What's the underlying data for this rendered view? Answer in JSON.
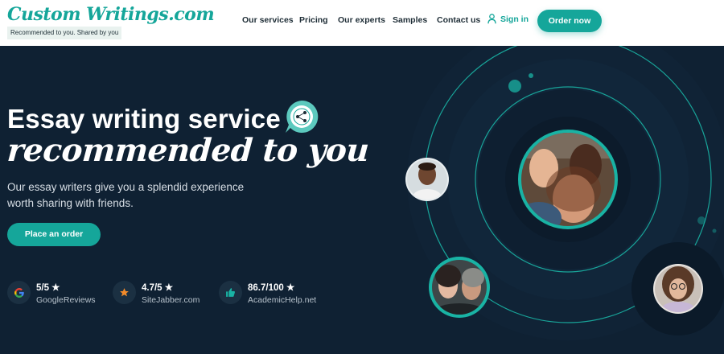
{
  "header": {
    "logo": "Custom Writings.com",
    "tagline": "Recommended to you. Shared by you",
    "nav": [
      "Our services",
      "Pricing",
      "Our experts",
      "Samples",
      "Contact us"
    ],
    "signin": "Sign in",
    "order_button": "Order now"
  },
  "hero": {
    "title": "Essay writing service",
    "title_script": "recommended to you",
    "subtitle": "Our essay writers give you a splendid experience worth sharing with friends.",
    "cta": "Place an order",
    "ratings": [
      {
        "score": "5/5 ★",
        "source": "GoogleReviews",
        "icon": "google-icon"
      },
      {
        "score": "4.7/5 ★",
        "source": "SiteJabber.com",
        "icon": "star-icon"
      },
      {
        "score": "86.7/100 ★",
        "source": "AcademicHelp.net",
        "icon": "thumbs-up-icon"
      }
    ]
  },
  "colors": {
    "accent": "#15a69a",
    "hero_bg": "#0f2133",
    "text_dark": "#1e2d36"
  }
}
